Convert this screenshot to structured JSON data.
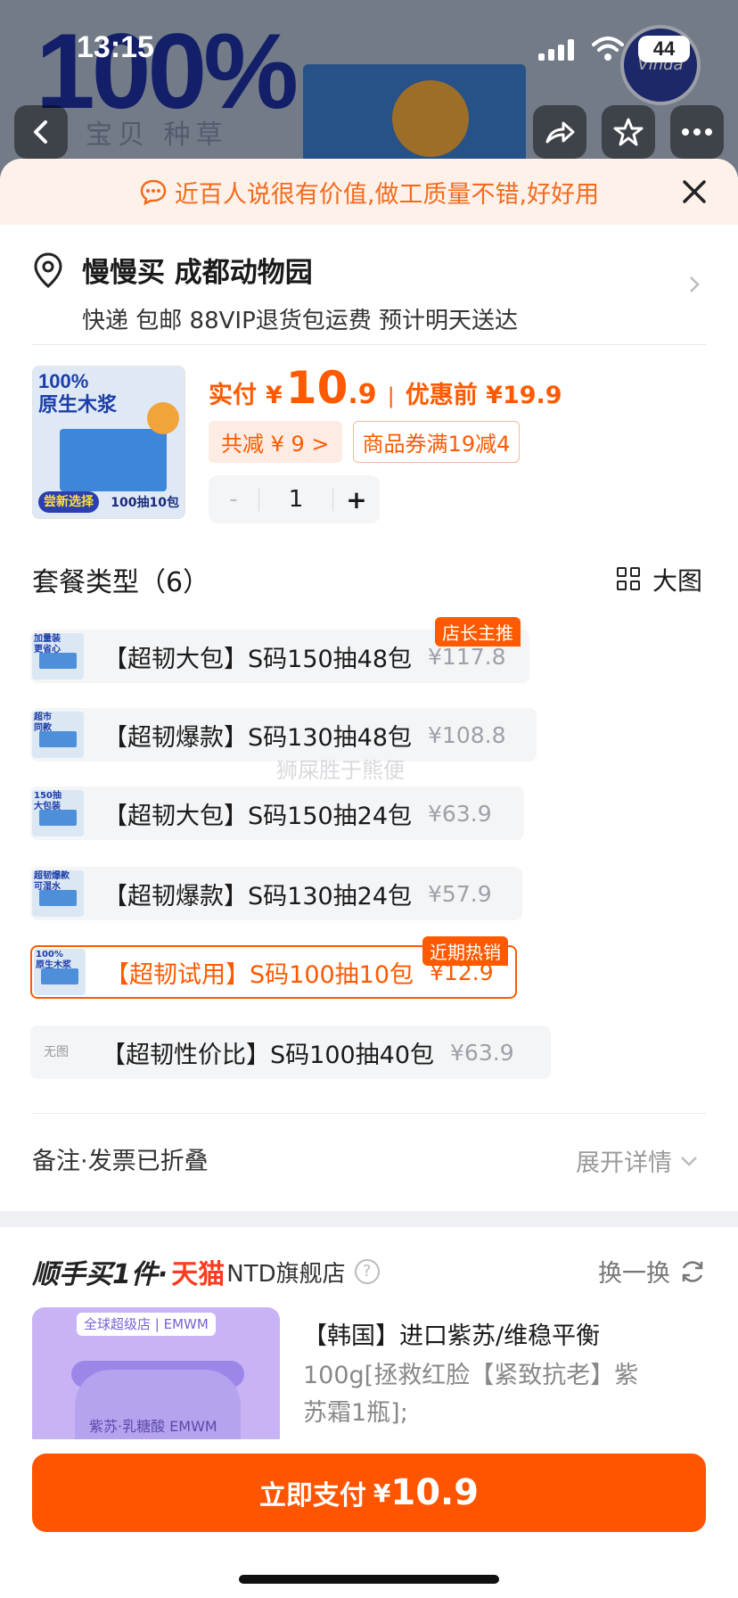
{
  "status_bar": {
    "time": "13:15",
    "battery": "44"
  },
  "banner": {
    "big_text": "100%",
    "tabs": "宝贝 种草",
    "logo": "Vinda"
  },
  "tip": {
    "text": "近百人说很有价值,做工质量不错,好好用"
  },
  "address": {
    "name": "慢慢买 成都动物园",
    "delivery": "快递 包邮 88VIP退货包运费 预计明天送达"
  },
  "product": {
    "image_text_top": "100%\n原生木浆",
    "image_badge": "尝新选择",
    "image_count": "100抽10包",
    "price_label": "实付",
    "currency": "¥",
    "price_int": "10",
    "price_dec": ".9",
    "separator": "|",
    "orig_price": "优惠前 ¥19.9",
    "discount_tag": "共减 ¥ 9 >",
    "coupon_tag": "商品券满19减4",
    "stepper": {
      "minus": "-",
      "value": "1",
      "plus": "+"
    }
  },
  "packages": {
    "title": "套餐类型（6）",
    "big_pic_label": "大图",
    "items": [
      {
        "label": "【超韧大包】S码150抽48包",
        "price": "¥117.8",
        "badge": "店长主推",
        "thumb": "加量装\n更省心"
      },
      {
        "label": "【超韧爆款】S码130抽48包",
        "price": "¥108.8",
        "badge": "",
        "thumb": "超市\n同款"
      },
      {
        "label": "【超韧大包】S码150抽24包",
        "price": "¥63.9",
        "badge": "",
        "thumb": "150抽\n大包装"
      },
      {
        "label": "【超韧爆款】S码130抽24包",
        "price": "¥57.9",
        "badge": "",
        "thumb": "超韧爆款\n可湿水"
      },
      {
        "label": "【超韧试用】S码100抽10包",
        "price": "¥12.9",
        "badge": "近期热销",
        "thumb": "100%\n原生木浆"
      },
      {
        "label": "【超韧性价比】S码100抽40包",
        "price": "¥63.9",
        "badge": "",
        "thumb": "无图"
      }
    ],
    "watermark": "狮屎胜于熊便"
  },
  "notes": {
    "label": "备注·发票已折叠",
    "expand": "展开详情"
  },
  "recommend": {
    "prefix": "顺手买1件·",
    "brand": "天猫",
    "shop": "NTD旗舰店",
    "swap": "换一换",
    "image_header": "全球超级店 | EMWM",
    "image_jar_text": "紫苏·乳糖酸 EMWM",
    "title": "【韩国】进口紫苏/维稳平衡",
    "desc": "100g[拯救红脸【紧致抗老】紫苏霜1瓶];"
  },
  "pay": {
    "label": "立即支付",
    "currency": "¥",
    "amount": "10.9"
  },
  "colors": {
    "accent": "#ff5500",
    "accent_text": "#ff5a00",
    "tip_bg": "#fdf1ea"
  }
}
